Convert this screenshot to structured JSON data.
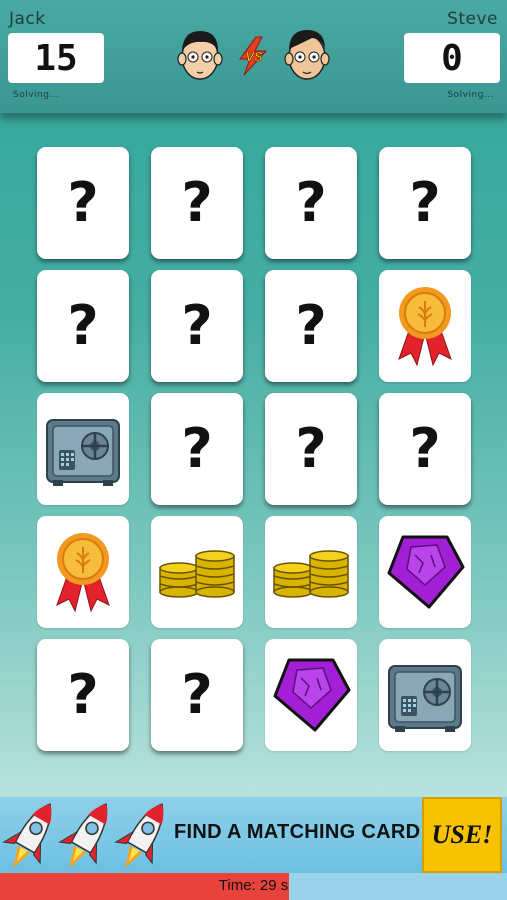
{
  "players": {
    "left": {
      "name": "Jack",
      "score": "15",
      "status": "Solving..."
    },
    "right": {
      "name": "Steve",
      "score": "0",
      "status": "Solving..."
    }
  },
  "vs_label": "VS",
  "board": {
    "rows": 5,
    "cols": 4,
    "hidden_symbol": "?",
    "cards": [
      "hidden",
      "hidden",
      "hidden",
      "hidden",
      "hidden",
      "hidden",
      "hidden",
      "medal-icon",
      "safe-icon",
      "hidden",
      "hidden",
      "hidden",
      "medal-icon",
      "coins-icon",
      "coins-icon",
      "gem-icon",
      "hidden",
      "hidden",
      "gem-icon",
      "safe-icon"
    ]
  },
  "powerup": {
    "label": "FIND A MATCHING CARD",
    "button": "USE!",
    "rockets": 3
  },
  "timer": {
    "label": "Time: 29 s",
    "fraction_remaining": 0.57
  },
  "colors": {
    "accent_yellow": "#f7c300",
    "timer_red": "#e8433b",
    "gem_purple": "#a21fd6"
  }
}
